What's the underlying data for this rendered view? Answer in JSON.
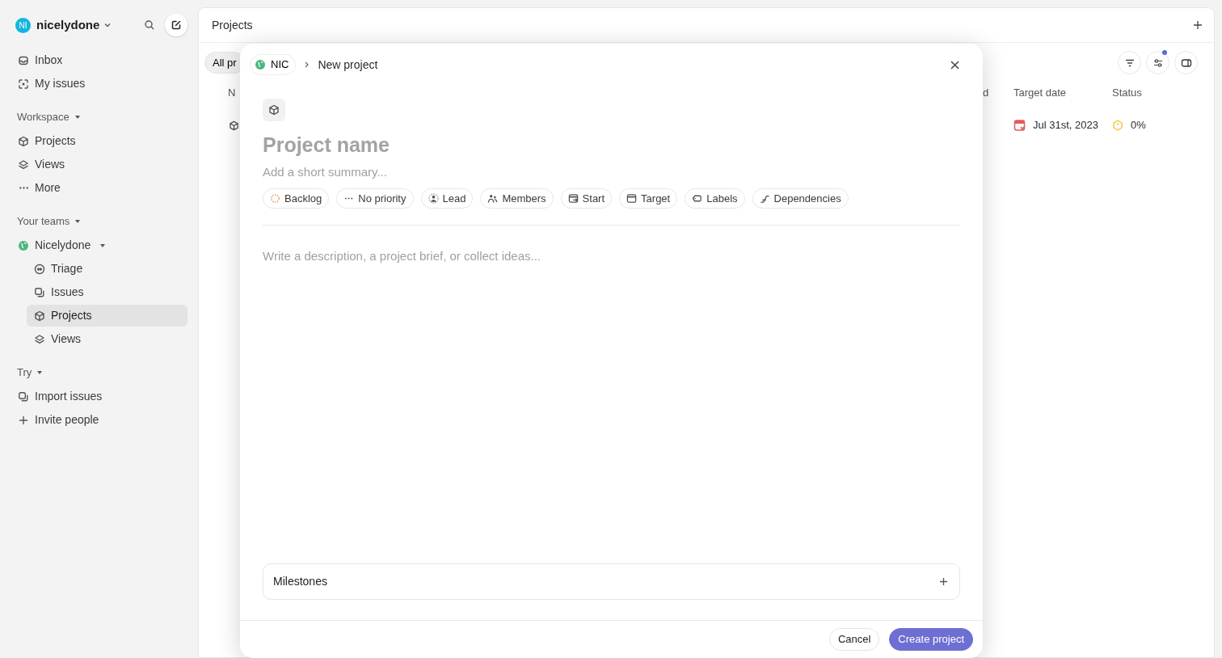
{
  "workspace": {
    "avatar": "NI",
    "name": "nicelydone"
  },
  "sidebar": {
    "top_items": [
      {
        "kind": "inbox",
        "label": "Inbox",
        "selected": false
      },
      {
        "kind": "my_issues",
        "label": "My issues",
        "selected": false
      }
    ],
    "sections": [
      {
        "title": "Workspace",
        "items": [
          {
            "kind": "projects",
            "label": "Projects",
            "selected": false
          },
          {
            "kind": "views",
            "label": "Views",
            "selected": false
          },
          {
            "kind": "more",
            "label": "More",
            "selected": false
          }
        ]
      },
      {
        "title": "Your teams",
        "items": [
          {
            "kind": "team",
            "label": "Nicelydone",
            "selected": false,
            "expandable": true,
            "children": [
              {
                "kind": "triage",
                "label": "Triage",
                "selected": false
              },
              {
                "kind": "issues",
                "label": "Issues",
                "selected": false
              },
              {
                "kind": "projects",
                "label": "Projects",
                "selected": true
              },
              {
                "kind": "views",
                "label": "Views",
                "selected": false
              }
            ]
          }
        ]
      },
      {
        "title": "Try",
        "items": [
          {
            "kind": "issues",
            "label": "Import issues",
            "selected": false
          },
          {
            "kind": "invite",
            "label": "Invite people",
            "selected": false
          }
        ]
      }
    ]
  },
  "main": {
    "title": "Projects",
    "tab": "All pr",
    "filter_indicator": true,
    "columns": [
      "N",
      "d",
      "Target date",
      "Status"
    ],
    "rows": [
      {
        "target_date": "Jul 31st, 2023",
        "status": "0%"
      }
    ]
  },
  "modal": {
    "team": "NIC",
    "breadcrumb": "New project",
    "name_placeholder": "Project name",
    "summary_placeholder": "Add a short summary...",
    "properties": [
      {
        "kind": "backlog",
        "label": "Backlog"
      },
      {
        "kind": "priority",
        "label": "No priority"
      },
      {
        "kind": "lead",
        "label": "Lead"
      },
      {
        "kind": "members",
        "label": "Members"
      },
      {
        "kind": "start",
        "label": "Start"
      },
      {
        "kind": "target",
        "label": "Target"
      },
      {
        "kind": "labels",
        "label": "Labels"
      },
      {
        "kind": "dependencies",
        "label": "Dependencies"
      }
    ],
    "description_placeholder": "Write a description, a project brief, or collect ideas...",
    "milestones": "Milestones",
    "buttons": [
      {
        "kind": "secondary",
        "label": "Cancel"
      },
      {
        "kind": "primary",
        "label": "Create project"
      }
    ]
  }
}
